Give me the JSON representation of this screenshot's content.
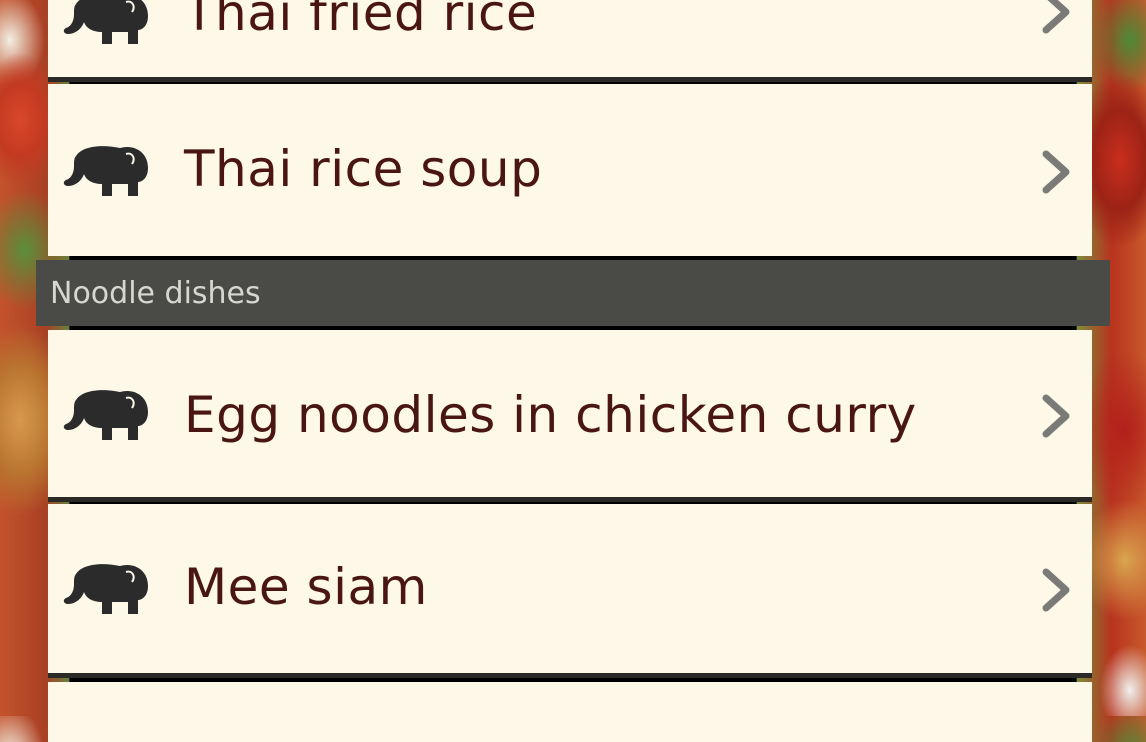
{
  "list": {
    "items_top": [
      {
        "label": "Thai fried rice",
        "icon": "elephant-icon",
        "chevron": "chevron-right-icon"
      },
      {
        "label": "Thai rice soup",
        "icon": "elephant-icon",
        "chevron": "chevron-right-icon"
      }
    ],
    "section": {
      "title": "Noodle dishes"
    },
    "items_bottom": [
      {
        "label": "Egg noodles in chicken curry",
        "icon": "elephant-icon",
        "chevron": "chevron-right-icon"
      },
      {
        "label": "Mee siam",
        "icon": "elephant-icon",
        "chevron": "chevron-right-icon"
      }
    ]
  },
  "colors": {
    "row_background": "#fdf8e8",
    "label_text": "#4a1614",
    "section_background": "#4a4a47",
    "section_text": "#d7d7d2",
    "chevron": "#7a7a76",
    "icon": "#2b2b2b"
  }
}
